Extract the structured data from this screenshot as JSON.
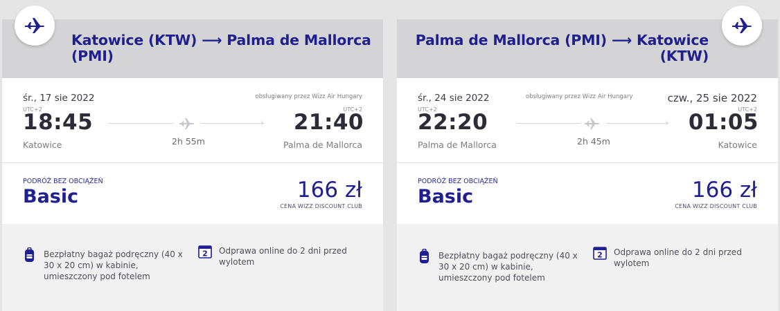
{
  "colors": {
    "brand": "#1f1f8f",
    "page_bg": "#e5e5e6",
    "route_bg": "#d4d4d6",
    "info_bg": "#f1f1f2"
  },
  "outbound": {
    "route_line1": "Katowice (KTW) ⟶ Palma de Mallorca",
    "route_line2": "(PMI)",
    "plane_icon": "plane-icon",
    "departure_date": "śr., 17 sie 2022",
    "operated_by": "obsługiwany przez Wizz Air Hungary",
    "departure_utc": "UTC+2",
    "arrival_utc": "UTC+2",
    "departure_time": "18:45",
    "arrival_time": "21:40",
    "duration": "2h 55m",
    "departure_city": "Katowice",
    "arrival_city": "Palma de Mallorca",
    "fare_label": "PODRÓŻ BEZ OBCIĄŻEŃ",
    "fare_name": "Basic",
    "price": "166 zł",
    "club_label": "CENA WIZZ DISCOUNT CLUB",
    "feature_bag": "Bezpłatny bagaż podręczny (40 x 30 x 20 cm) w kabinie, umieszczony pod fotelem",
    "feature_checkin": "Odprawa online do 2 dni przed wylotem",
    "checkin_days": "2"
  },
  "inbound": {
    "route_line1": "Palma de Mallorca (PMI) ⟶ Katowice",
    "route_line2": "(KTW)",
    "plane_icon": "plane-icon",
    "departure_date": "śr., 24 sie 2022",
    "arrival_date": "czw., 25 sie 2022",
    "operated_by": "obsługiwany przez Wizz Air Hungary",
    "departure_utc": "UTC+2",
    "arrival_utc": "UTC+2",
    "departure_time": "22:20",
    "arrival_time": "01:05",
    "duration": "2h 45m",
    "departure_city": "Palma de Mallorca",
    "arrival_city": "Katowice",
    "fare_label": "PODRÓŻ BEZ OBCIĄŻEŃ",
    "fare_name": "Basic",
    "price": "166 zł",
    "club_label": "CENA WIZZ DISCOUNT CLUB",
    "feature_bag": "Bezpłatny bagaż podręczny (40 x 30 x 20 cm) w kabinie, umieszczony pod fotelem",
    "feature_checkin": "Odprawa online do 2 dni przed wylotem",
    "checkin_days": "2"
  }
}
